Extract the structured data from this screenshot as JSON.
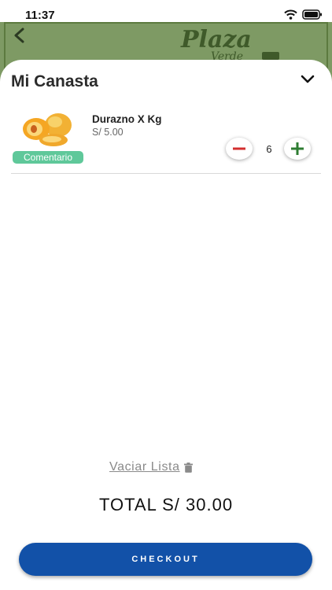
{
  "status_bar": {
    "time": "11:37"
  },
  "header": {
    "logo_line1": "Plaza",
    "logo_line2": "Verde"
  },
  "sheet": {
    "title": "Mi Canasta"
  },
  "cart": {
    "items": [
      {
        "name": "Durazno X Kg",
        "price": "S/ 5.00",
        "quantity": "6",
        "comment_label": "Comentario"
      }
    ]
  },
  "footer": {
    "clear_label": "Vaciar Lista",
    "total": "TOTAL S/ 30.00",
    "checkout_label": "CHECKOUT"
  },
  "colors": {
    "accent_green": "#5fc89a",
    "checkout_blue": "#1251a8",
    "minus_red": "#d32f2f",
    "plus_green": "#2e7d32"
  }
}
